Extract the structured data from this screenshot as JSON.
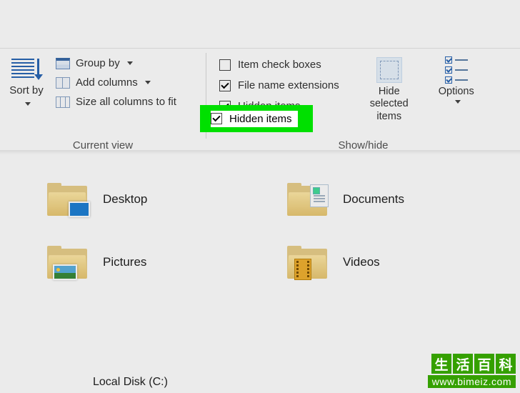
{
  "ribbon": {
    "current_view": {
      "label": "Current view",
      "sort_by": "Sort by",
      "group_by": "Group by",
      "add_columns": "Add columns",
      "size_columns": "Size all columns to fit"
    },
    "show_hide": {
      "label": "Show/hide",
      "item_check_boxes": {
        "label": "Item check boxes",
        "checked": false
      },
      "file_name_extensions": {
        "label": "File name extensions",
        "checked": true
      },
      "hidden_items": {
        "label": "Hidden items",
        "checked": true
      },
      "hide_selected": "Hide selected items",
      "options": "Options"
    }
  },
  "folders": {
    "desktop": "Desktop",
    "documents": "Documents",
    "pictures": "Pictures",
    "videos": "Videos"
  },
  "drive": "Local Disk (C:)",
  "watermark": {
    "c1": "生",
    "c2": "活",
    "c3": "百",
    "c4": "科",
    "url": "www.bimeiz.com"
  }
}
